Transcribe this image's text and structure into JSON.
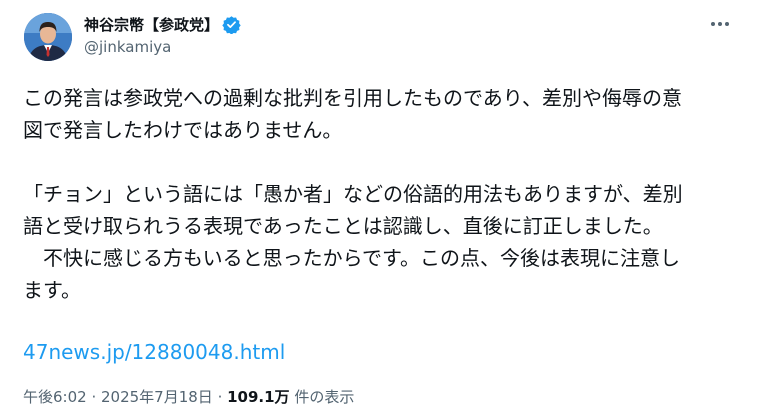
{
  "author": {
    "display_name": "神谷宗幣【参政党】",
    "handle": "@jinkamiya",
    "verified_icon": "verified-badge-icon",
    "verified_color": "#1d9bf0"
  },
  "tweet": {
    "lines": [
      "この発言は参政党への過剰な批判を引用したものであり、差別や侮辱の意",
      "図で発言したわけではありません。",
      "",
      "「チョン」という語には「愚か者」などの俗語的用法もありますが、差別",
      "語と受け取られうる表現であったことは認識し、直後に訂正しました。",
      "　不快に感じる方もいると思ったからです。この点、今後は表現に注意し",
      "ます。"
    ],
    "link_text": "47news.jp/12880048.html"
  },
  "meta": {
    "time": "午後6:02 · 2025年7月18日",
    "separator": " · ",
    "views_count": "109.1万",
    "views_label": " 件の表示"
  },
  "icons": {
    "more": "more-options-icon"
  },
  "colors": {
    "text": "#0f1419",
    "secondary": "#536471",
    "link": "#1d9bf0"
  }
}
